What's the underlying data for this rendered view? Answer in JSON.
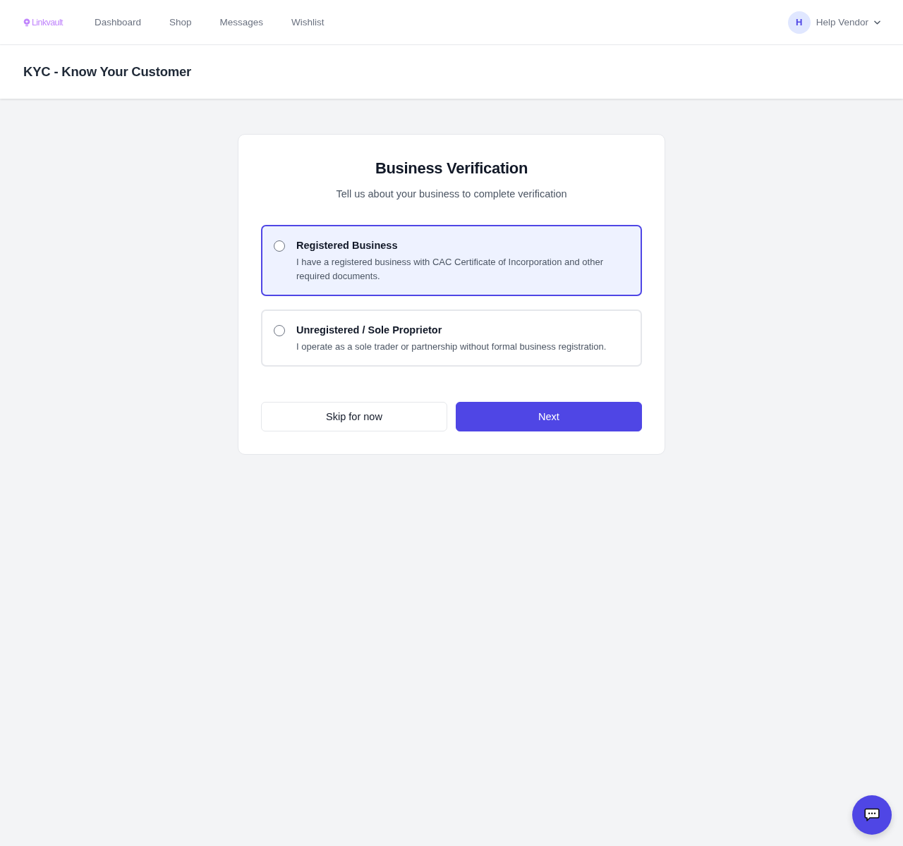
{
  "navbar": {
    "logo": "Linkvault",
    "links": [
      {
        "label": "Dashboard"
      },
      {
        "label": "Shop"
      },
      {
        "label": "Messages"
      },
      {
        "label": "Wishlist"
      }
    ],
    "user": {
      "initial": "H",
      "name": "Help Vendor"
    }
  },
  "page_header": {
    "title": "KYC - Know Your Customer"
  },
  "card": {
    "title": "Business Verification",
    "subtitle": "Tell us about your business to complete verification",
    "options": [
      {
        "title": "Registered Business",
        "description": "I have a registered business with CAC Certificate of Incorporation and other required documents.",
        "selected": true,
        "checked": false
      },
      {
        "title": "Unregistered / Sole Proprietor",
        "description": "I operate as a sole trader or partnership without formal business registration.",
        "selected": false,
        "checked": false
      }
    ],
    "buttons": [
      {
        "label": "Skip for now",
        "kind": "secondary"
      },
      {
        "label": "Next",
        "kind": "primary"
      }
    ]
  }
}
